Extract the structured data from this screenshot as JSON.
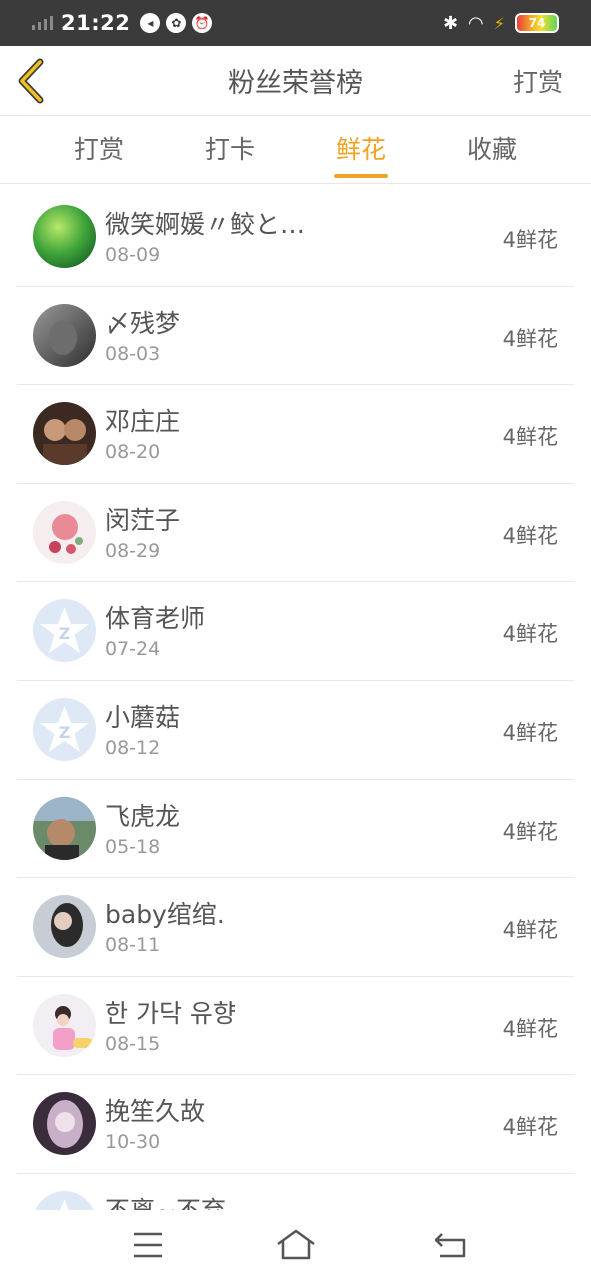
{
  "status_bar": {
    "time": "21:22",
    "battery": "74"
  },
  "nav": {
    "title": "粉丝荣誉榜",
    "action": "打赏"
  },
  "tabs": [
    {
      "label": "打赏",
      "active": false
    },
    {
      "label": "打卡",
      "active": false
    },
    {
      "label": "鲜花",
      "active": true
    },
    {
      "label": "收藏",
      "active": false
    }
  ],
  "colors": {
    "accent": "#f0a324",
    "status_bg": "#3b3b3b"
  },
  "list": [
    {
      "name": "微笑婀媛〃鲛と…",
      "date": "08-09",
      "count": "4鲜花"
    },
    {
      "name": "〆残梦",
      "date": "08-03",
      "count": "4鲜花"
    },
    {
      "name": "邓庄庄",
      "date": "08-20",
      "count": "4鲜花"
    },
    {
      "name": "闵茳子",
      "date": "08-29",
      "count": "4鲜花"
    },
    {
      "name": "体育老师",
      "date": "07-24",
      "count": "4鲜花"
    },
    {
      "name": "小蘑菇",
      "date": "08-12",
      "count": "4鲜花"
    },
    {
      "name": "飞虎龙",
      "date": "05-18",
      "count": "4鲜花"
    },
    {
      "name": "baby绾绾.",
      "date": "08-11",
      "count": "4鲜花"
    },
    {
      "name": "한 가닥 유향",
      "date": "08-15",
      "count": "4鲜花"
    },
    {
      "name": "挽笙久故",
      "date": "10-30",
      "count": "4鲜花"
    },
    {
      "name": "不离~不弃",
      "date": "",
      "count": ""
    }
  ]
}
